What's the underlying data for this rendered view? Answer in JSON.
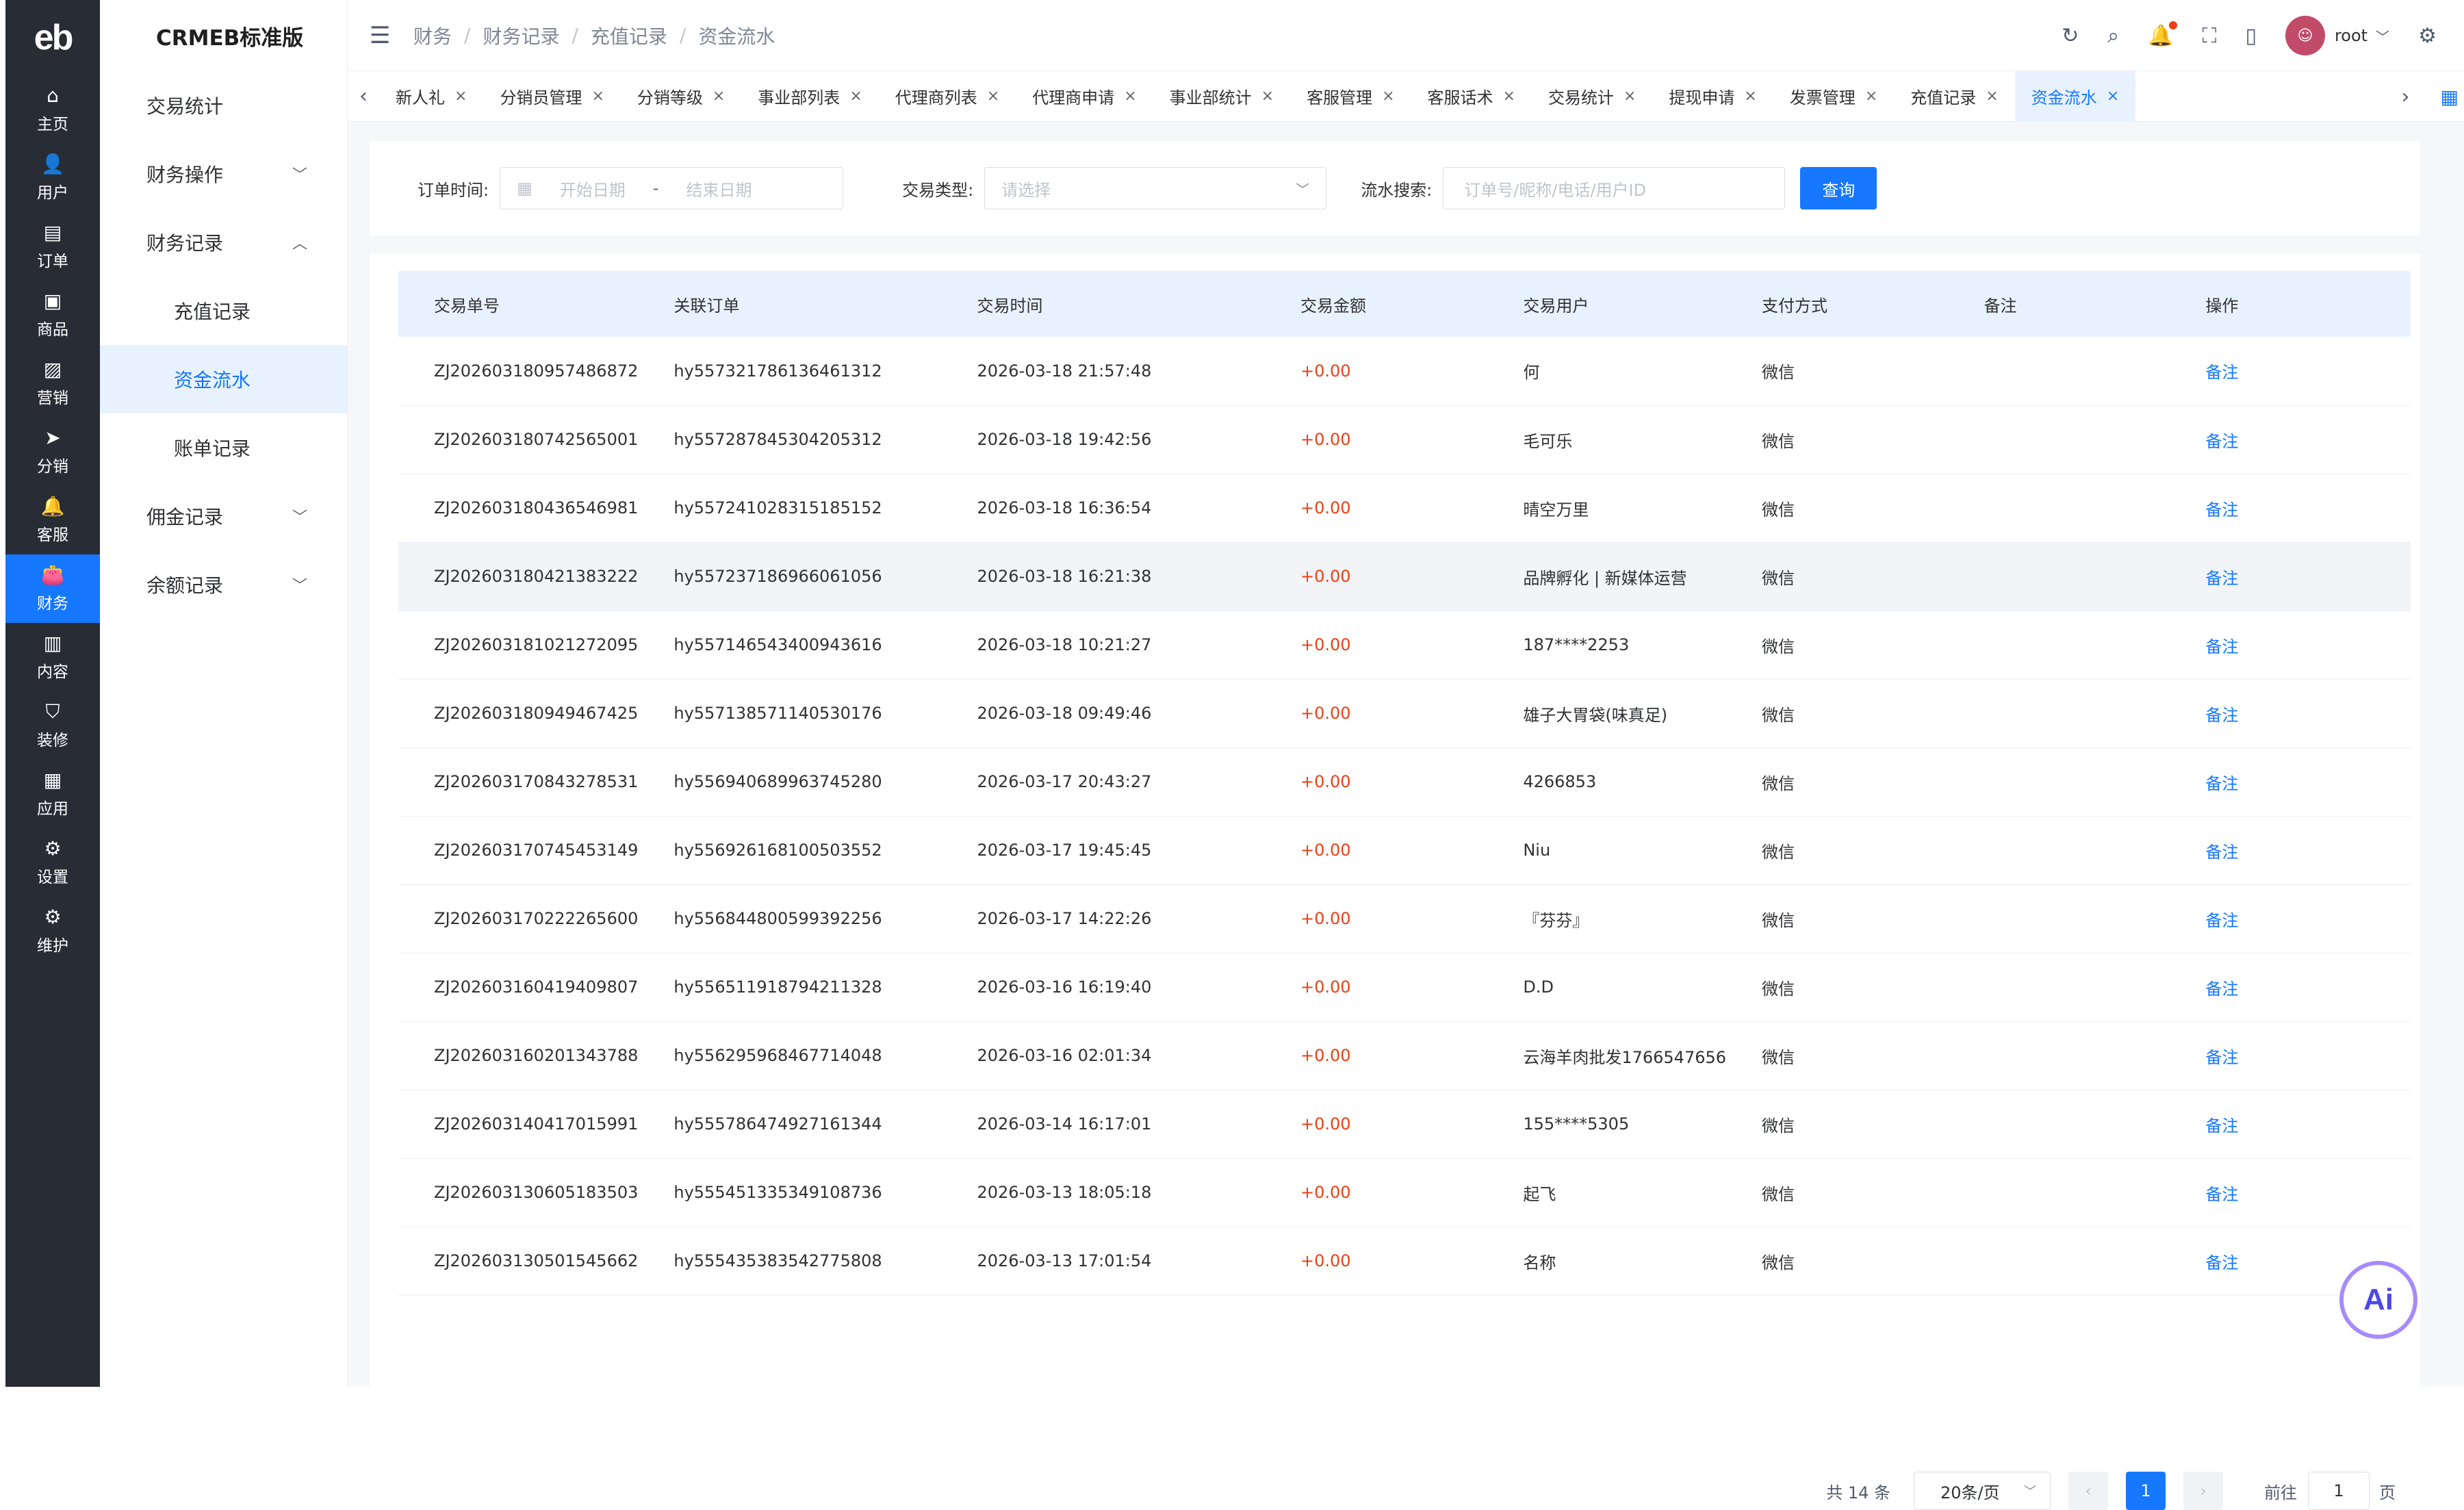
{
  "rail": {
    "logo": "eb",
    "items": [
      {
        "label": "主页",
        "icon": "home-icon",
        "glyph": "⌂"
      },
      {
        "label": "用户",
        "icon": "user-icon",
        "glyph": "👤"
      },
      {
        "label": "订单",
        "icon": "order-icon",
        "glyph": "▤"
      },
      {
        "label": "商品",
        "icon": "product-icon",
        "glyph": "▣"
      },
      {
        "label": "营销",
        "icon": "marketing-icon",
        "glyph": "▨"
      },
      {
        "label": "分销",
        "icon": "distribution-icon",
        "glyph": "➤"
      },
      {
        "label": "客服",
        "icon": "service-icon",
        "glyph": "🔔"
      },
      {
        "label": "财务",
        "icon": "finance-icon",
        "glyph": "👛"
      },
      {
        "label": "内容",
        "icon": "content-icon",
        "glyph": "▥"
      },
      {
        "label": "装修",
        "icon": "decorate-icon",
        "glyph": "⛉"
      },
      {
        "label": "应用",
        "icon": "apps-icon",
        "glyph": "▦"
      },
      {
        "label": "设置",
        "icon": "settings-icon",
        "glyph": "⚙"
      },
      {
        "label": "维护",
        "icon": "maintain-icon",
        "glyph": "⚙"
      }
    ],
    "active_index": 7
  },
  "submenu": {
    "title": "CRMEB标准版",
    "items": [
      {
        "label": "交易统计",
        "chevron": ""
      },
      {
        "label": "财务操作",
        "chevron": "﹀"
      },
      {
        "label": "财务记录",
        "chevron": "︿"
      },
      {
        "label": "充值记录",
        "chevron": ""
      },
      {
        "label": "资金流水",
        "chevron": ""
      },
      {
        "label": "账单记录",
        "chevron": ""
      },
      {
        "label": "佣金记录",
        "chevron": "﹀"
      },
      {
        "label": "余额记录",
        "chevron": "﹀"
      }
    ]
  },
  "header": {
    "breadcrumb": [
      "财务",
      "财务记录",
      "充值记录",
      "资金流水"
    ],
    "username": "root"
  },
  "tabs": [
    "新人礼",
    "分销员管理",
    "分销等级",
    "事业部列表",
    "代理商列表",
    "代理商申请",
    "事业部统计",
    "客服管理",
    "客服话术",
    "交易统计",
    "提现申请",
    "发票管理",
    "充值记录",
    "资金流水"
  ],
  "filter": {
    "order_time_label": "订单时间:",
    "start_placeholder": "开始日期",
    "end_placeholder": "结束日期",
    "date_sep": "-",
    "type_label": "交易类型:",
    "type_placeholder": "请选择",
    "search_label": "流水搜索:",
    "search_placeholder": "订单号/昵称/电话/用户ID",
    "query_button": "查询"
  },
  "table": {
    "columns": [
      "交易单号",
      "关联订单",
      "交易时间",
      "交易金额",
      "交易用户",
      "支付方式",
      "备注",
      "操作"
    ],
    "rows": [
      [
        "ZJ202603180957486872",
        "hy557321786136461312",
        "2026-03-18 21:57:48",
        "+0.00",
        "何",
        "微信",
        "",
        "备注"
      ],
      [
        "ZJ202603180742565001",
        "hy557287845304205312",
        "2026-03-18 19:42:56",
        "+0.00",
        "毛可乐",
        "微信",
        "",
        "备注"
      ],
      [
        "ZJ202603180436546981",
        "hy557241028315185152",
        "2026-03-18 16:36:54",
        "+0.00",
        "晴空万里",
        "微信",
        "",
        "备注"
      ],
      [
        "ZJ202603180421383222",
        "hy557237186966061056",
        "2026-03-18 16:21:38",
        "+0.00",
        "品牌孵化 | 新媒体运营",
        "微信",
        "",
        "备注"
      ],
      [
        "ZJ202603181021272095",
        "hy557146543400943616",
        "2026-03-18 10:21:27",
        "+0.00",
        "187****2253",
        "微信",
        "",
        "备注"
      ],
      [
        "ZJ202603180949467425",
        "hy557138571140530176",
        "2026-03-18 09:49:46",
        "+0.00",
        "雄子大胃袋(味真足)",
        "微信",
        "",
        "备注"
      ],
      [
        "ZJ202603170843278531",
        "hy556940689963745280",
        "2026-03-17 20:43:27",
        "+0.00",
        "4266853",
        "微信",
        "",
        "备注"
      ],
      [
        "ZJ202603170745453149",
        "hy556926168100503552",
        "2026-03-17 19:45:45",
        "+0.00",
        "Niu",
        "微信",
        "",
        "备注"
      ],
      [
        "ZJ202603170222265600",
        "hy556844800599392256",
        "2026-03-17 14:22:26",
        "+0.00",
        "『芬芬』",
        "微信",
        "",
        "备注"
      ],
      [
        "ZJ202603160419409807",
        "hy556511918794211328",
        "2026-03-16 16:19:40",
        "+0.00",
        "D.D",
        "微信",
        "",
        "备注"
      ],
      [
        "ZJ202603160201343788",
        "hy556295968467714048",
        "2026-03-16 02:01:34",
        "+0.00",
        "云海羊肉批发1766547656",
        "微信",
        "",
        "备注"
      ],
      [
        "ZJ202603140417015991",
        "hy555786474927161344",
        "2026-03-14 16:17:01",
        "+0.00",
        "155****5305",
        "微信",
        "",
        "备注"
      ],
      [
        "ZJ202603130605183503",
        "hy555451335349108736",
        "2026-03-13 18:05:18",
        "+0.00",
        "起飞",
        "微信",
        "",
        "备注"
      ],
      [
        "ZJ202603130501545662",
        "hy555435383542775808",
        "2026-03-13 17:01:54",
        "+0.00",
        "名称",
        "微信",
        "",
        "备注"
      ]
    ],
    "highlight_row": 3
  },
  "pagination": {
    "total": "共 14 条",
    "page_size": "20条/页",
    "current_page": "1",
    "goto_label": "前往",
    "goto_value": "1",
    "page_unit": "页"
  },
  "ai_button": "Ai",
  "colors": {
    "accent": "#1677ff",
    "rail_bg": "#282c34",
    "amount": "#ed4014"
  }
}
